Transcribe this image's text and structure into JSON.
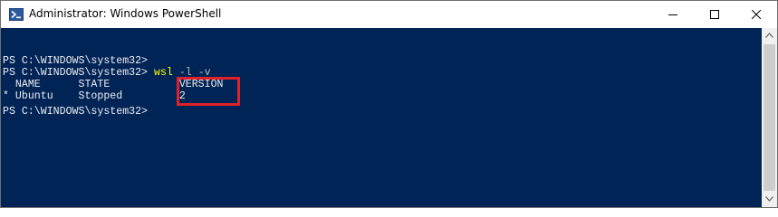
{
  "window": {
    "title": "Administrator: Windows PowerShell",
    "icon": "powershell-icon",
    "controls": {
      "minimize_icon": "minimize-icon",
      "maximize_icon": "maximize-icon",
      "close_icon": "close-icon"
    }
  },
  "console": {
    "background": "#012456",
    "foreground": "#eeedf0",
    "lines": [
      "PS C:\\WINDOWS\\system32>",
      "  NAME      STATE           ",
      "* Ubuntu    Stopped         ",
      "PS C:\\WINDOWS\\system32>"
    ],
    "command_line": {
      "prompt": "PS C:\\WINDOWS\\system32> ",
      "command": "wsl",
      "args": " -l -v"
    },
    "header_version": "VERSION",
    "row_version": "2",
    "highlight_color": "#e0212b",
    "command_color": "#ffff00",
    "args_color": "#b8b8b8"
  },
  "scrollbar": {
    "up_icon": "scroll-up-arrow-icon",
    "down_icon": "scroll-down-arrow-icon"
  }
}
